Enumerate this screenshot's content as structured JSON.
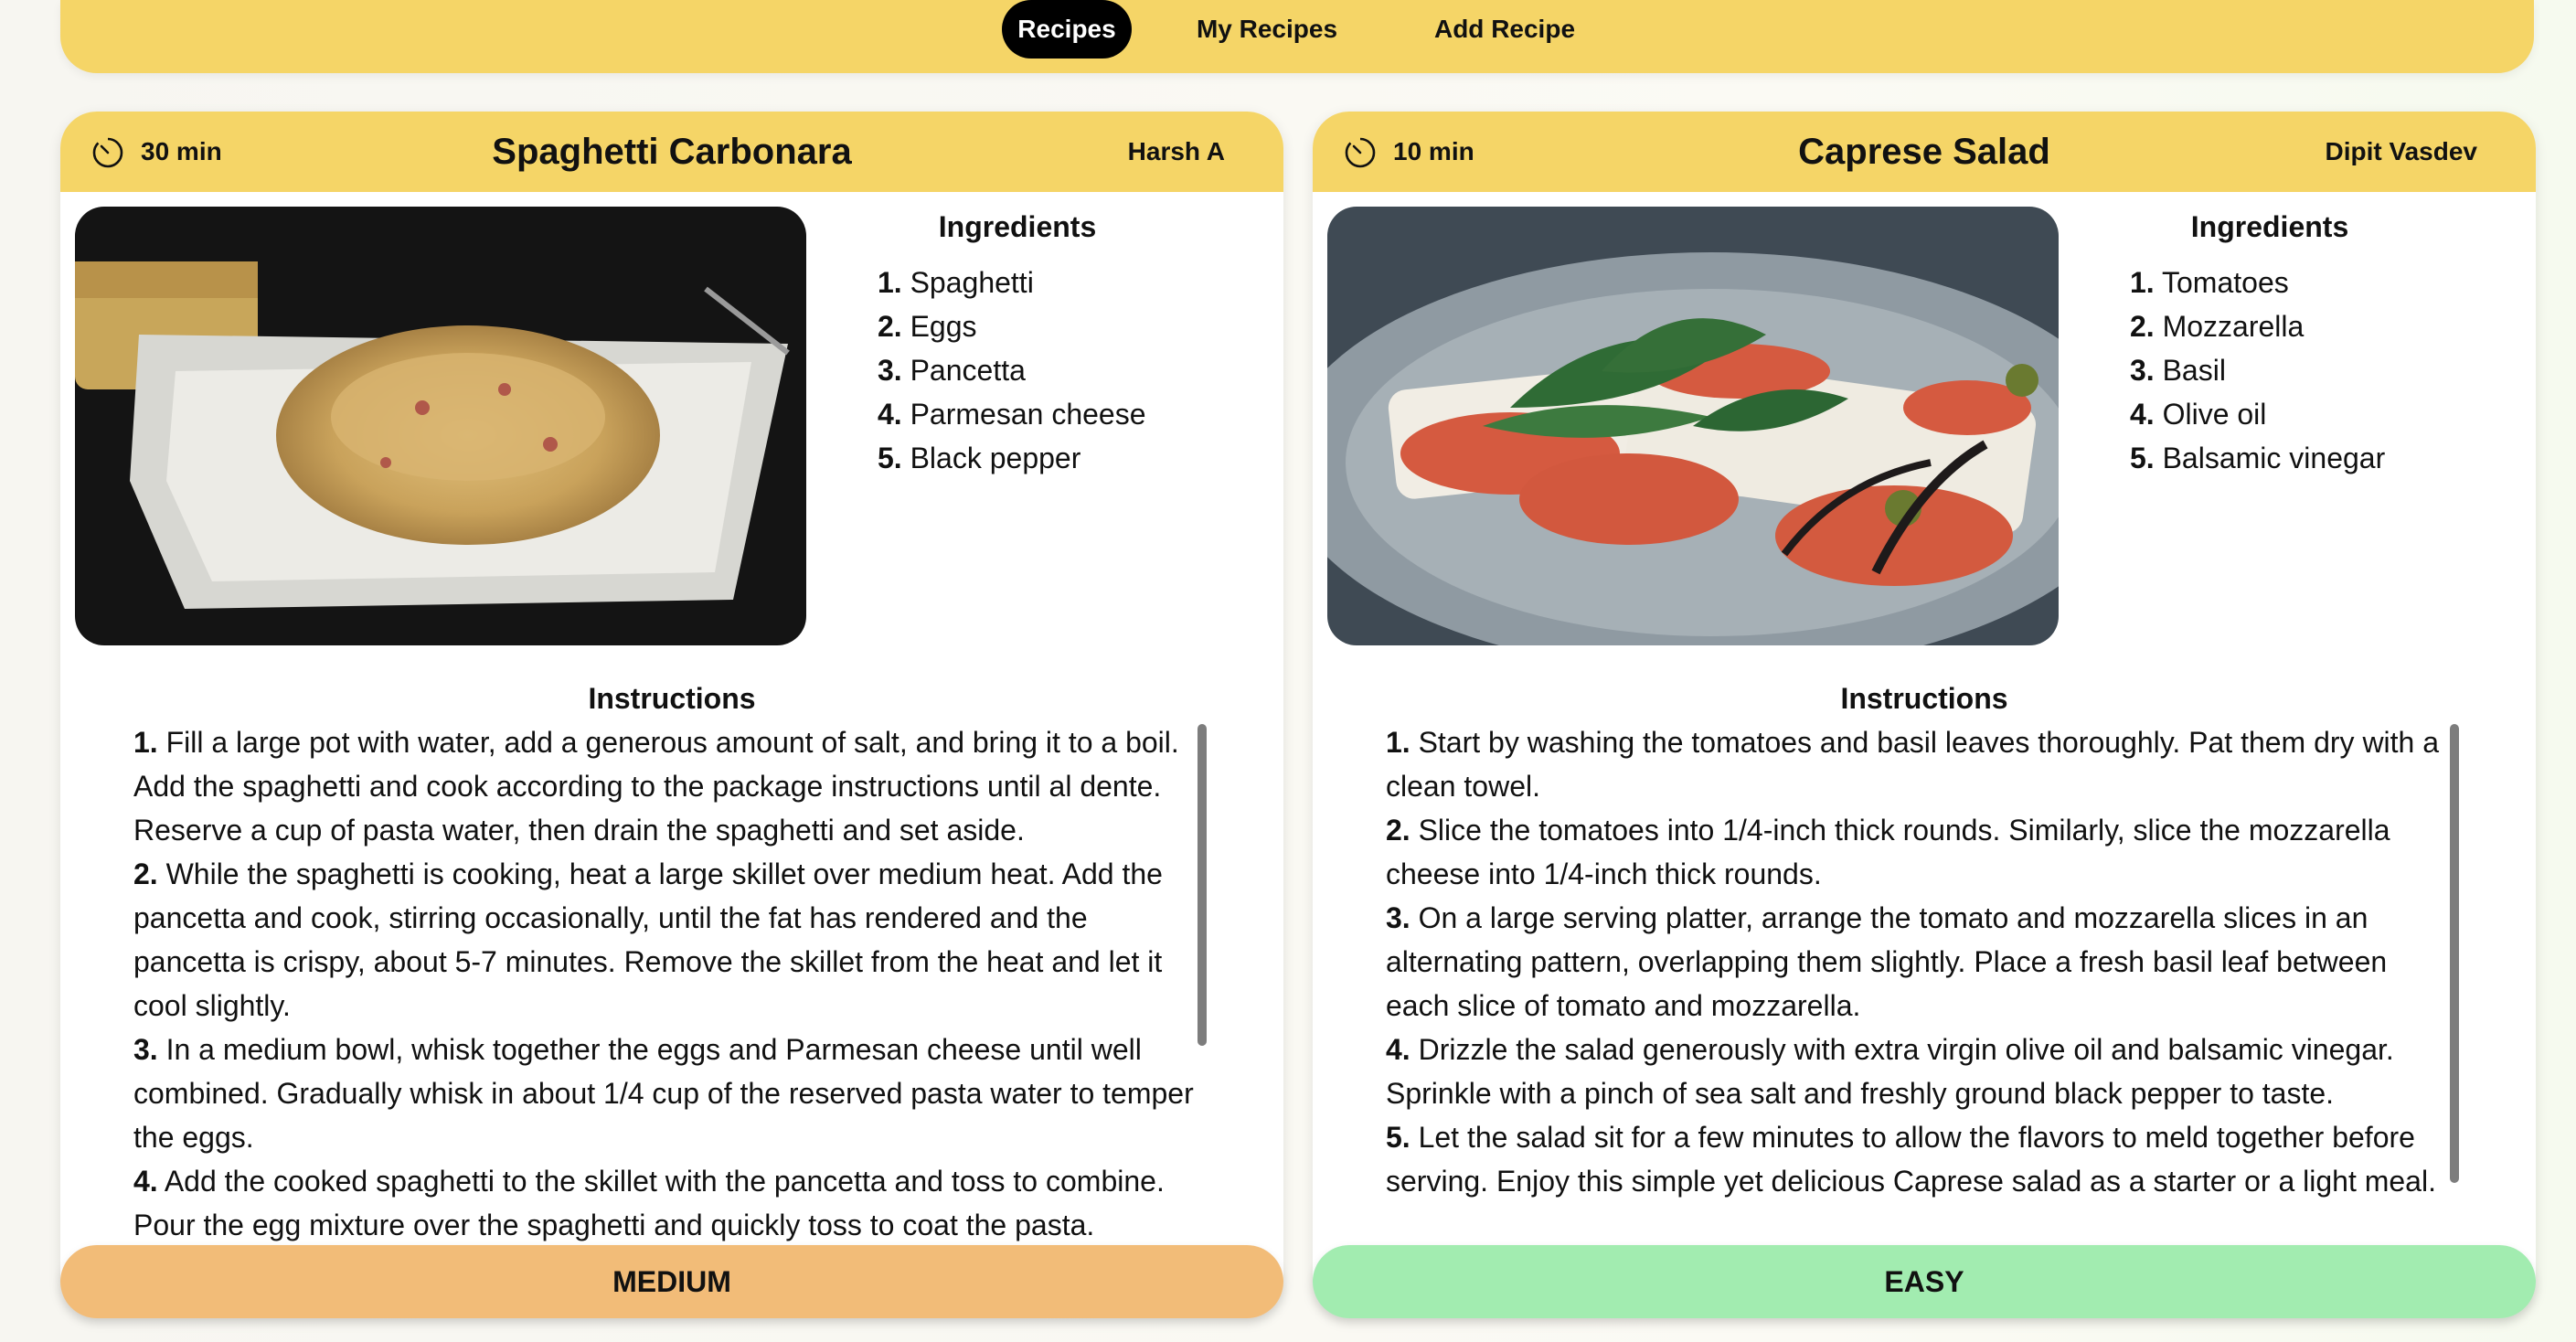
{
  "nav": {
    "items": [
      "Recipes",
      "My Recipes",
      "Add Recipe"
    ],
    "active": "Recipes"
  },
  "colors": {
    "header": "#f5d567",
    "medium": "#f2bc78",
    "easy": "#a2ecb0",
    "active_tab": "#000000"
  },
  "recipes": [
    {
      "time": "30 min",
      "title": "Spaghetti Carbonara",
      "author": "Harsh A",
      "ingredients_title": "Ingredients",
      "ingredients": [
        {
          "n": "1.",
          "text": "Spaghetti"
        },
        {
          "n": "2.",
          "text": "Eggs"
        },
        {
          "n": "3.",
          "text": "Pancetta"
        },
        {
          "n": "4.",
          "text": "Parmesan cheese"
        },
        {
          "n": "5.",
          "text": "Black pepper"
        }
      ],
      "instructions_title": "Instructions",
      "instructions": [
        {
          "n": "1.",
          "text": "Fill a large pot with water, add a generous amount of salt, and bring it to a boil. Add the spaghetti and cook according to the package instructions until al dente. Reserve a cup of pasta water, then drain the spaghetti and set aside."
        },
        {
          "n": "2.",
          "text": "While the spaghetti is cooking, heat a large skillet over medium heat. Add the pancetta and cook, stirring occasionally, until the fat has rendered and the pancetta is crispy, about 5-7 minutes. Remove the skillet from the heat and let it cool slightly."
        },
        {
          "n": "3.",
          "text": "In a medium bowl, whisk together the eggs and Parmesan cheese until well combined. Gradually whisk in about 1/4 cup of the reserved pasta water to temper the eggs."
        },
        {
          "n": "4.",
          "text": "Add the cooked spaghetti to the skillet with the pancetta and toss to combine. Pour the egg mixture over the spaghetti and quickly toss to coat the pasta."
        }
      ],
      "difficulty": "MEDIUM"
    },
    {
      "time": "10 min",
      "title": "Caprese Salad",
      "author": "Dipit Vasdev",
      "ingredients_title": "Ingredients",
      "ingredients": [
        {
          "n": "1.",
          "text": "Tomatoes"
        },
        {
          "n": "2.",
          "text": "Mozzarella"
        },
        {
          "n": "3.",
          "text": "Basil"
        },
        {
          "n": "4.",
          "text": "Olive oil"
        },
        {
          "n": "5.",
          "text": "Balsamic vinegar"
        }
      ],
      "instructions_title": "Instructions",
      "instructions": [
        {
          "n": "1.",
          "text": "Start by washing the tomatoes and basil leaves thoroughly. Pat them dry with a clean towel."
        },
        {
          "n": "2.",
          "text": "Slice the tomatoes into 1/4-inch thick rounds. Similarly, slice the mozzarella cheese into 1/4-inch thick rounds."
        },
        {
          "n": "3.",
          "text": "On a large serving platter, arrange the tomato and mozzarella slices in an alternating pattern, overlapping them slightly. Place a fresh basil leaf between each slice of tomato and mozzarella."
        },
        {
          "n": "4.",
          "text": "Drizzle the salad generously with extra virgin olive oil and balsamic vinegar. Sprinkle with a pinch of sea salt and freshly ground black pepper to taste."
        },
        {
          "n": "5.",
          "text": "Let the salad sit for a few minutes to allow the flavors to meld together before serving. Enjoy this simple yet delicious Caprese salad as a starter or a light meal."
        }
      ],
      "difficulty": "EASY"
    }
  ]
}
